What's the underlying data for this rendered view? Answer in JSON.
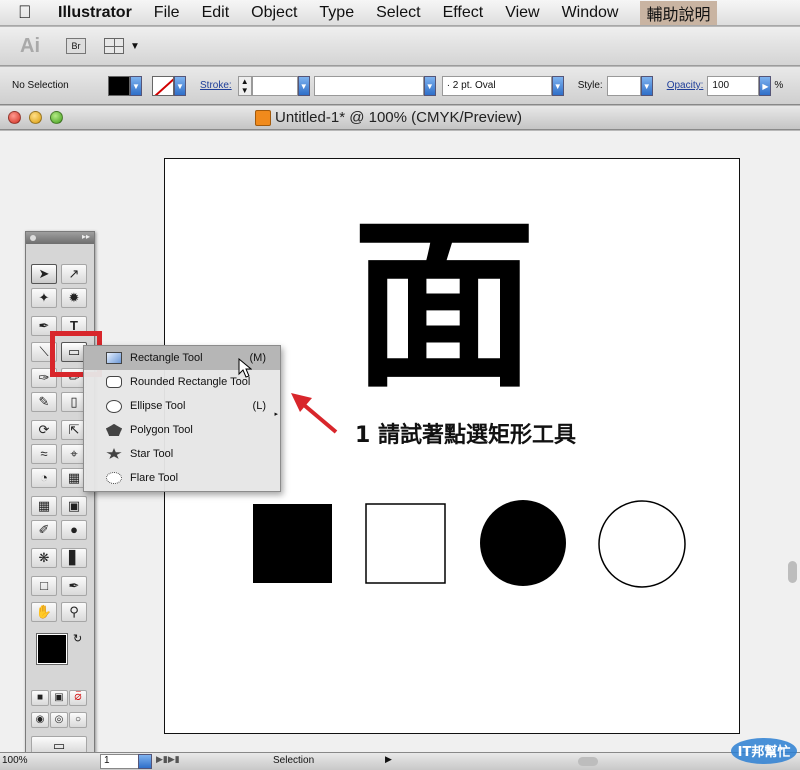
{
  "menubar": {
    "items": [
      "Illustrator",
      "File",
      "Edit",
      "Object",
      "Type",
      "Select",
      "Effect",
      "View",
      "Window",
      "輔助說明"
    ]
  },
  "appbar": {
    "ai_label": "Ai",
    "br_label": "Br"
  },
  "controlbar": {
    "selection_label": "No Selection",
    "stroke_label": "Stroke:",
    "brush_value": "· 2 pt. Oval",
    "style_label": "Style:",
    "opacity_label": "Opacity:",
    "opacity_value": "100",
    "percent": "%"
  },
  "window": {
    "title": "Untitled-1* @ 100% (CMYK/Preview)"
  },
  "artboard": {
    "big_char": "面",
    "instruction": "1  請試著點選矩形工具"
  },
  "flyout": {
    "items": [
      {
        "label": "Rectangle Tool",
        "shortcut": "(M)",
        "icon": "rectangle-icon"
      },
      {
        "label": "Rounded Rectangle Tool",
        "shortcut": "",
        "icon": "rounded-rectangle-icon"
      },
      {
        "label": "Ellipse Tool",
        "shortcut": "(L)",
        "icon": "ellipse-icon"
      },
      {
        "label": "Polygon Tool",
        "shortcut": "",
        "icon": "polygon-icon"
      },
      {
        "label": "Star Tool",
        "shortcut": "",
        "icon": "star-icon"
      },
      {
        "label": "Flare Tool",
        "shortcut": "",
        "icon": "flare-icon"
      }
    ]
  },
  "statusbar": {
    "zoom": "100%",
    "page": "1",
    "status": "Selection"
  },
  "watermark": {
    "text": "IT邦幫忙"
  },
  "colors": {
    "highlight": "#d8262b",
    "arrow": "#d8262b",
    "selected_flyout": "#b6b6b6"
  }
}
